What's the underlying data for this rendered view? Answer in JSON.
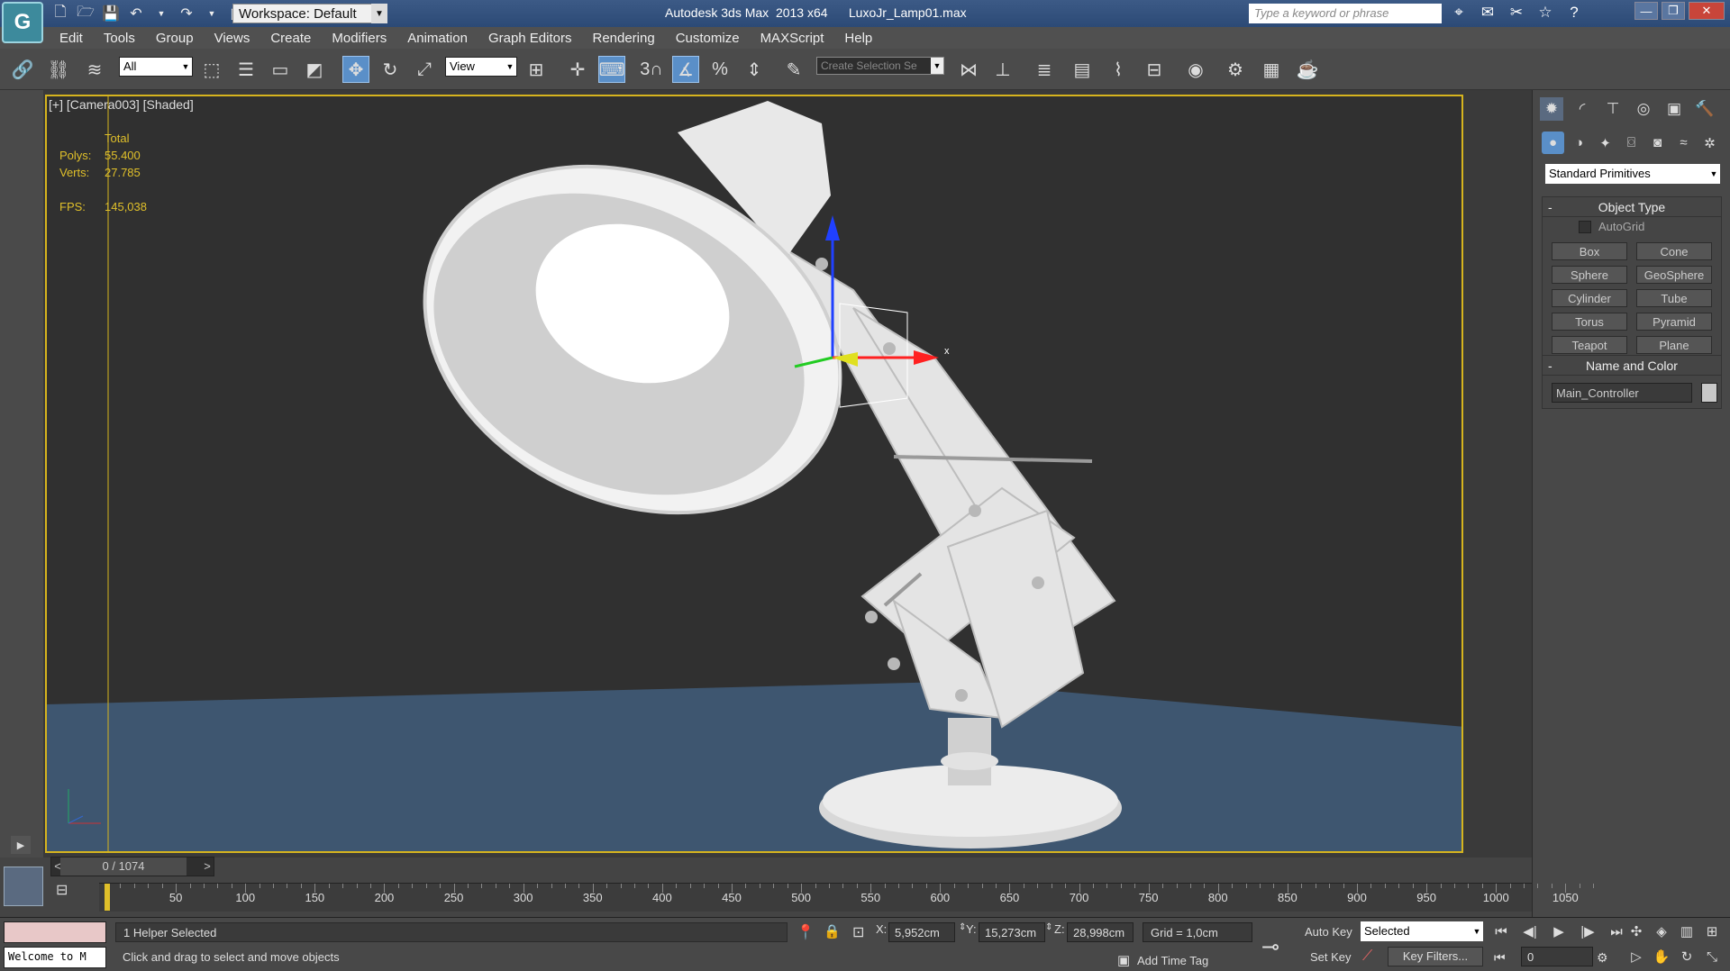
{
  "titlebar": {
    "workspace": "Workspace: Default",
    "app_title": "Autodesk 3ds Max  2013 x64      LuxoJr_Lamp01.max",
    "search_placeholder": "Type a keyword or phrase"
  },
  "menu": [
    "Edit",
    "Tools",
    "Group",
    "Views",
    "Create",
    "Modifiers",
    "Animation",
    "Graph Editors",
    "Rendering",
    "Customize",
    "MAXScript",
    "Help"
  ],
  "toolbar": {
    "selection_filter": "All",
    "ref_coord": "View",
    "snap_label": "3",
    "named_selection_placeholder": "Create Selection Se"
  },
  "viewport": {
    "label": "[+] [Camera003] [Shaded]",
    "stats": {
      "header": "Total",
      "polys_label": "Polys:",
      "polys": "55.400",
      "verts_label": "Verts:",
      "verts": "27.785",
      "fps_label": "FPS:",
      "fps": "145,038"
    },
    "gizmo_axis_label": "x",
    "colors": {
      "floor": "#3e5670",
      "background": "#303030",
      "border": "#d6b41e"
    }
  },
  "command_panel": {
    "primitive_type": "Standard Primitives",
    "object_type_title": "Object Type",
    "autogrid_label": "AutoGrid",
    "buttons": [
      "Box",
      "Cone",
      "Sphere",
      "GeoSphere",
      "Cylinder",
      "Tube",
      "Torus",
      "Pyramid",
      "Teapot",
      "Plane"
    ],
    "name_color_title": "Name and Color",
    "object_name": "Main_Controller",
    "collapse_symbol": "-"
  },
  "timeline": {
    "frame_display": "0 / 1074",
    "ticks": [
      "50",
      "100",
      "150",
      "200",
      "250",
      "300",
      "350",
      "400",
      "450",
      "500",
      "550",
      "600",
      "650",
      "700",
      "750",
      "800",
      "850",
      "900",
      "950",
      "1000",
      "1050"
    ]
  },
  "status": {
    "maxscript_listener": "Welcome to M",
    "selection_status": "1 Helper Selected",
    "prompt": "Click and drag to select and move objects",
    "x_label": "X:",
    "x_value": "5,952cm",
    "y_label": "Y:",
    "y_value": "15,273cm",
    "z_label": "Z:",
    "z_value": "28,998cm",
    "grid": "Grid = 1,0cm",
    "add_time_tag": "Add Time Tag",
    "auto_key": "Auto Key",
    "set_key": "Set Key",
    "key_mode": "Selected",
    "key_filters": "Key Filters...",
    "current_frame": "0"
  }
}
